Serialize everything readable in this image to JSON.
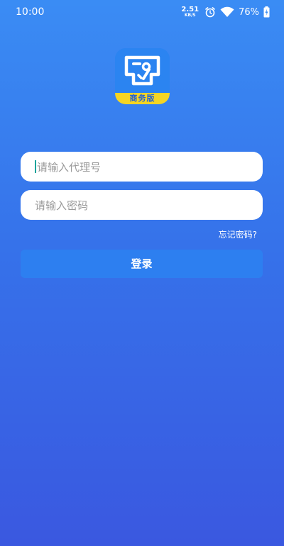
{
  "status_bar": {
    "time": "10:00",
    "net_speed_value": "2.51",
    "net_speed_unit": "KB/S",
    "battery_percent": "76%"
  },
  "logo": {
    "ribbon_text": "商务版",
    "colors": {
      "tile": "#2b84f1",
      "ribbon": "#f5d524"
    }
  },
  "form": {
    "username_placeholder": "请输入代理号",
    "password_placeholder": "请输入密码",
    "forgot_password": "忘记密码?",
    "login_label": "登录"
  },
  "colors": {
    "background_top": "#3a8cf4",
    "background_bottom": "#3a58e0",
    "button": "#2d7ff0",
    "caret": "#0fa39b"
  }
}
